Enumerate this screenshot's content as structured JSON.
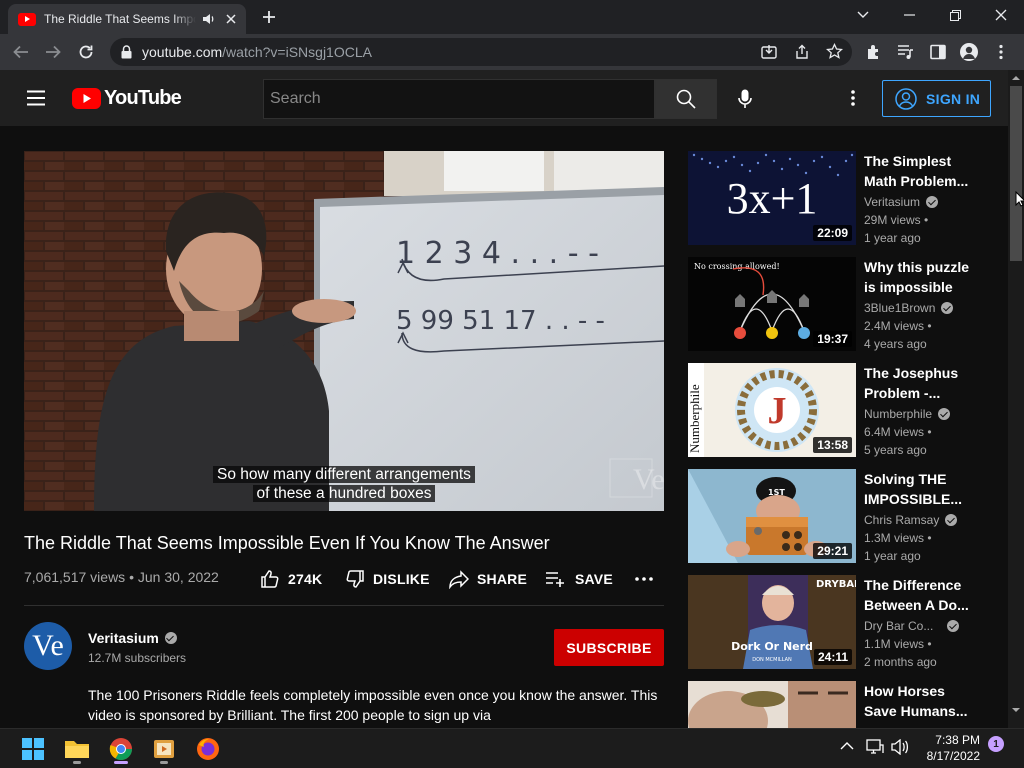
{
  "browser": {
    "tab_title": "The Riddle That Seems Impossible Even If You Know The Answer",
    "url_host": "youtube.com",
    "url_path": "/watch?v=iSNsgj1OCLA"
  },
  "header": {
    "logo_text": "YouTube",
    "search_placeholder": "Search",
    "signin_label": "SIGN IN"
  },
  "video": {
    "board_line1": "1 2 3 4 . . . - -",
    "board_line2": "5 99 51 17 . . - -",
    "caption_line1": "So how many different arrangements",
    "caption_line2": "of these a hundred boxes",
    "watermark": "Ve",
    "title": "The Riddle That Seems Impossible Even If You Know The Answer",
    "views": "7,061,517 views",
    "date": "Jun 30, 2022",
    "likes": "274K",
    "dislike_label": "DISLIKE",
    "share_label": "SHARE",
    "save_label": "SAVE"
  },
  "channel": {
    "avatar_text": "Ve",
    "name": "Veritasium",
    "subscribers": "12.7M subscribers",
    "subscribe_label": "SUBSCRIBE",
    "description": "The 100 Prisoners Riddle feels completely impossible even once you know the answer. This video is sponsored by Brilliant. The first 200 people to sign up via"
  },
  "recommendations": [
    {
      "title": "The Simplest Math Problem...",
      "channel": "Veritasium",
      "views": "29M views",
      "age": "1 year ago",
      "duration": "22:09",
      "thumb_text": "3x+1"
    },
    {
      "title": "Why this puzzle is impossible",
      "channel": "3Blue1Brown",
      "views": "2.4M views",
      "age": "4 years ago",
      "duration": "19:37",
      "thumb_text": "No crossing allowed!"
    },
    {
      "title": "The Josephus Problem -...",
      "channel": "Numberphile",
      "views": "6.4M views",
      "age": "5 years ago",
      "duration": "13:58",
      "thumb_text": "Numberphile",
      "thumb_letter": "J"
    },
    {
      "title": "Solving THE IMPOSSIBLE...",
      "channel": "Chris Ramsay",
      "views": "1.3M views",
      "age": "1 year ago",
      "duration": "29:21",
      "thumb_text": "1ST"
    },
    {
      "title": "The Difference Between A Do...",
      "channel": "Dry Bar Co...",
      "views": "1.1M views",
      "age": "2 months ago",
      "duration": "24:11",
      "thumb_text": "Dork Or Nerd",
      "thumb_sub": "DON MCMILLAN",
      "thumb_brand": "DRYBAR"
    },
    {
      "title": "How Horses Save Humans...",
      "channel": "",
      "views": "",
      "age": "",
      "duration": ""
    }
  ],
  "taskbar": {
    "time": "7:38 PM",
    "date": "8/17/2022",
    "notification_count": "1"
  },
  "colors": {
    "accent_blue": "#3ea6ff",
    "subscribe_red": "#cc0000",
    "youtube_red": "#ff0000",
    "page_bg": "#0f0f0f"
  }
}
